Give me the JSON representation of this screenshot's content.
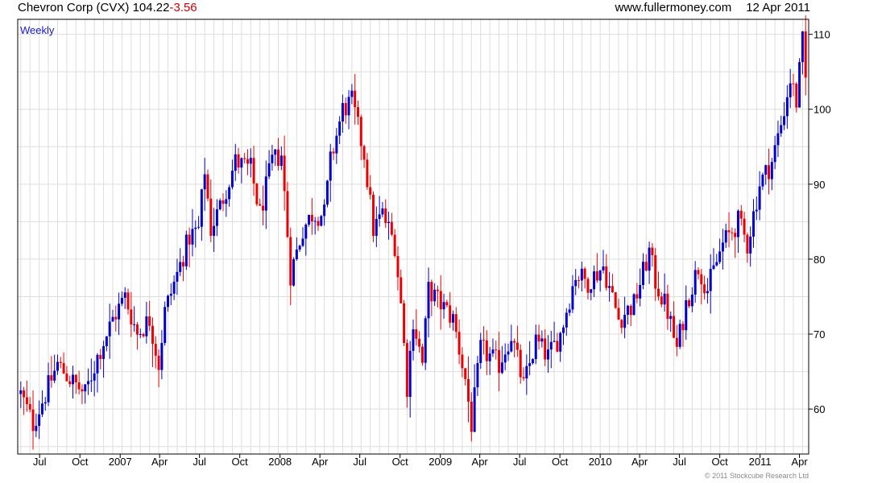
{
  "header": {
    "title": "Chevron Corp (CVX)",
    "last": "104.22",
    "change": "-3.56",
    "site": "www.fullermoney.com",
    "date": "12 Apr 2011"
  },
  "footer": {
    "copyright": "© 2011 Stockcube Research Ltd"
  },
  "colors": {
    "up": "#0000cc",
    "down": "#ee0000",
    "grid": "#dddddd",
    "axis": "#000000"
  },
  "chart_data": {
    "type": "candlestick",
    "period_label": "Weekly",
    "ylim": [
      54,
      112
    ],
    "y_ticks": [
      60,
      70,
      80,
      90,
      100,
      110
    ],
    "x_range": [
      "2006-05-12",
      "2011-04-22"
    ],
    "x_ticks": [
      {
        "label": "Jul",
        "date": "2006-07-01"
      },
      {
        "label": "Oct",
        "date": "2006-10-01"
      },
      {
        "label": "2007",
        "date": "2007-01-01"
      },
      {
        "label": "Apr",
        "date": "2007-04-01"
      },
      {
        "label": "Jul",
        "date": "2007-07-01"
      },
      {
        "label": "Oct",
        "date": "2007-10-01"
      },
      {
        "label": "2008",
        "date": "2008-01-01"
      },
      {
        "label": "Apr",
        "date": "2008-04-01"
      },
      {
        "label": "Jul",
        "date": "2008-07-01"
      },
      {
        "label": "Oct",
        "date": "2008-10-01"
      },
      {
        "label": "2009",
        "date": "2009-01-01"
      },
      {
        "label": "Apr",
        "date": "2009-04-01"
      },
      {
        "label": "Jul",
        "date": "2009-07-01"
      },
      {
        "label": "Oct",
        "date": "2009-10-01"
      },
      {
        "label": "2010",
        "date": "2010-01-01"
      },
      {
        "label": "Apr",
        "date": "2010-04-01"
      },
      {
        "label": "Jul",
        "date": "2010-07-01"
      },
      {
        "label": "Oct",
        "date": "2010-10-01"
      },
      {
        "label": "2011",
        "date": "2011-01-01"
      },
      {
        "label": "Apr",
        "date": "2011-04-01"
      }
    ],
    "grid": true,
    "week_start": "2006-05-19",
    "close_path": [
      [
        "2006-05-19",
        62
      ],
      [
        "2006-06-16",
        58
      ],
      [
        "2006-07-14",
        62
      ],
      [
        "2006-08-11",
        66
      ],
      [
        "2006-09-08",
        64
      ],
      [
        "2006-10-13",
        62
      ],
      [
        "2006-11-10",
        67
      ],
      [
        "2006-12-15",
        72
      ],
      [
        "2007-01-12",
        75
      ],
      [
        "2007-02-09",
        70
      ],
      [
        "2007-03-09",
        72
      ],
      [
        "2007-03-30",
        66
      ],
      [
        "2007-04-13",
        73
      ],
      [
        "2007-05-11",
        78
      ],
      [
        "2007-06-08",
        83
      ],
      [
        "2007-06-29",
        84
      ],
      [
        "2007-07-13",
        92
      ],
      [
        "2007-07-27",
        84
      ],
      [
        "2007-08-17",
        87
      ],
      [
        "2007-09-21",
        93
      ],
      [
        "2007-10-26",
        92
      ],
      [
        "2007-11-16",
        86
      ],
      [
        "2007-12-14",
        93
      ],
      [
        "2008-01-04",
        94
      ],
      [
        "2008-01-25",
        78
      ],
      [
        "2008-02-22",
        84
      ],
      [
        "2008-03-14",
        86
      ],
      [
        "2008-04-11",
        86
      ],
      [
        "2008-04-25",
        93
      ],
      [
        "2008-05-23",
        100
      ],
      [
        "2008-06-13",
        101
      ],
      [
        "2008-07-11",
        94
      ],
      [
        "2008-08-01",
        84
      ],
      [
        "2008-08-22",
        86
      ],
      [
        "2008-09-19",
        82
      ],
      [
        "2008-10-03",
        74
      ],
      [
        "2008-10-17",
        63
      ],
      [
        "2008-10-31",
        72
      ],
      [
        "2008-11-21",
        66
      ],
      [
        "2008-12-05",
        76
      ],
      [
        "2009-01-02",
        74
      ],
      [
        "2009-01-30",
        72
      ],
      [
        "2009-02-27",
        64
      ],
      [
        "2009-03-13",
        58
      ],
      [
        "2009-04-03",
        68
      ],
      [
        "2009-05-15",
        66
      ],
      [
        "2009-06-12",
        70
      ],
      [
        "2009-07-10",
        63
      ],
      [
        "2009-08-07",
        69
      ],
      [
        "2009-09-04",
        67
      ],
      [
        "2009-10-02",
        70
      ],
      [
        "2009-11-06",
        78
      ],
      [
        "2009-12-04",
        77
      ],
      [
        "2010-01-08",
        79
      ],
      [
        "2010-02-12",
        72
      ],
      [
        "2010-03-19",
        74
      ],
      [
        "2010-04-23",
        81
      ],
      [
        "2010-05-07",
        77
      ],
      [
        "2010-06-04",
        73
      ],
      [
        "2010-06-25",
        68
      ],
      [
        "2010-07-16",
        74
      ],
      [
        "2010-08-13",
        79
      ],
      [
        "2010-09-03",
        76
      ],
      [
        "2010-10-08",
        82
      ],
      [
        "2010-11-12",
        85
      ],
      [
        "2010-12-03",
        82
      ],
      [
        "2010-12-31",
        90
      ],
      [
        "2011-01-28",
        93
      ],
      [
        "2011-02-18",
        98
      ],
      [
        "2011-03-11",
        104
      ],
      [
        "2011-03-25",
        101
      ],
      [
        "2011-04-08",
        109
      ],
      [
        "2011-04-15",
        104.22
      ]
    ]
  }
}
